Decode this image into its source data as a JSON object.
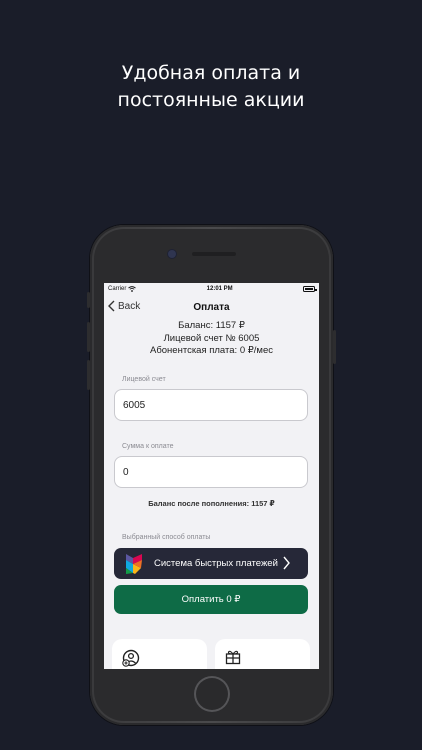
{
  "headline": {
    "line1": "Удобная оплата и",
    "line2": "постоянные акции"
  },
  "status_bar": {
    "carrier": "Carrier",
    "time": "12:01 PM"
  },
  "nav": {
    "back_label": "Back",
    "title": "Оплата"
  },
  "account_info": {
    "balance": "Баланс: 1157 ₽",
    "account_number": "Лицевой счет № 6005",
    "subscription_fee": "Абонентская плата: 0 ₽/мес"
  },
  "form": {
    "account_label": "Лицевой счет",
    "account_value": "6005",
    "amount_label": "Сумма к оплате",
    "amount_value": "0",
    "balance_after": "Баланс после пополнения: 1157 ₽"
  },
  "payment_method": {
    "label": "Выбранный способ оплаты",
    "selected": "Система быстрых платежей"
  },
  "pay_button": {
    "label": "Оплатить 0 ₽"
  },
  "colors": {
    "background": "#1a1d29",
    "accent_green": "#0e6b46",
    "sbp_dark": "#262838"
  },
  "icons": [
    "chevron-left-icon",
    "wifi-icon",
    "battery-icon",
    "sbp-logo-icon",
    "chevron-right-icon",
    "add-user-icon",
    "gift-icon"
  ]
}
